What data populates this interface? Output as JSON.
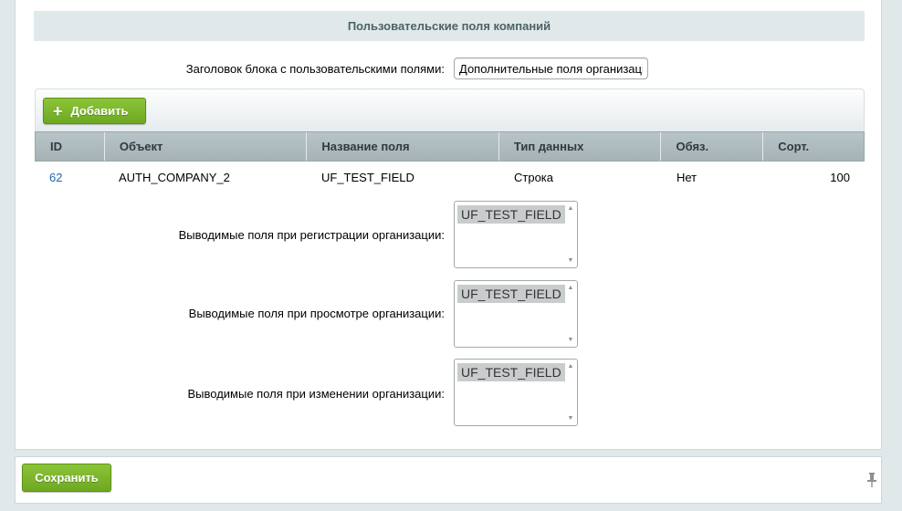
{
  "section": {
    "title": "Пользовательские поля компаний",
    "block_title_label": "Заголовок блока с пользовательскими полями:",
    "block_title_value": "Дополнительные поля организаці"
  },
  "toolbar": {
    "add_label": "Добавить"
  },
  "table": {
    "columns": [
      "ID",
      "Объект",
      "Название поля",
      "Тип данных",
      "Обяз.",
      "Сорт."
    ],
    "rows": [
      {
        "id": "62",
        "object": "AUTH_COMPANY_2",
        "field_name": "UF_TEST_FIELD",
        "data_type": "Строка",
        "required": "Нет",
        "sort": "100"
      }
    ]
  },
  "fields": {
    "registration_label": "Выводимые поля при регистрации организации:",
    "registration_selected": "UF_TEST_FIELD",
    "view_label": "Выводимые поля при просмотре организации:",
    "view_selected": "UF_TEST_FIELD",
    "edit_label": "Выводимые поля при изменении организации:",
    "edit_selected": "UF_TEST_FIELD"
  },
  "footer": {
    "save_label": "Сохранить",
    "pin_icon": "pin-icon"
  },
  "colors": {
    "accent_green": "#7ab42c",
    "link_blue": "#2067b0",
    "header_gray": "#a5b3b6"
  }
}
